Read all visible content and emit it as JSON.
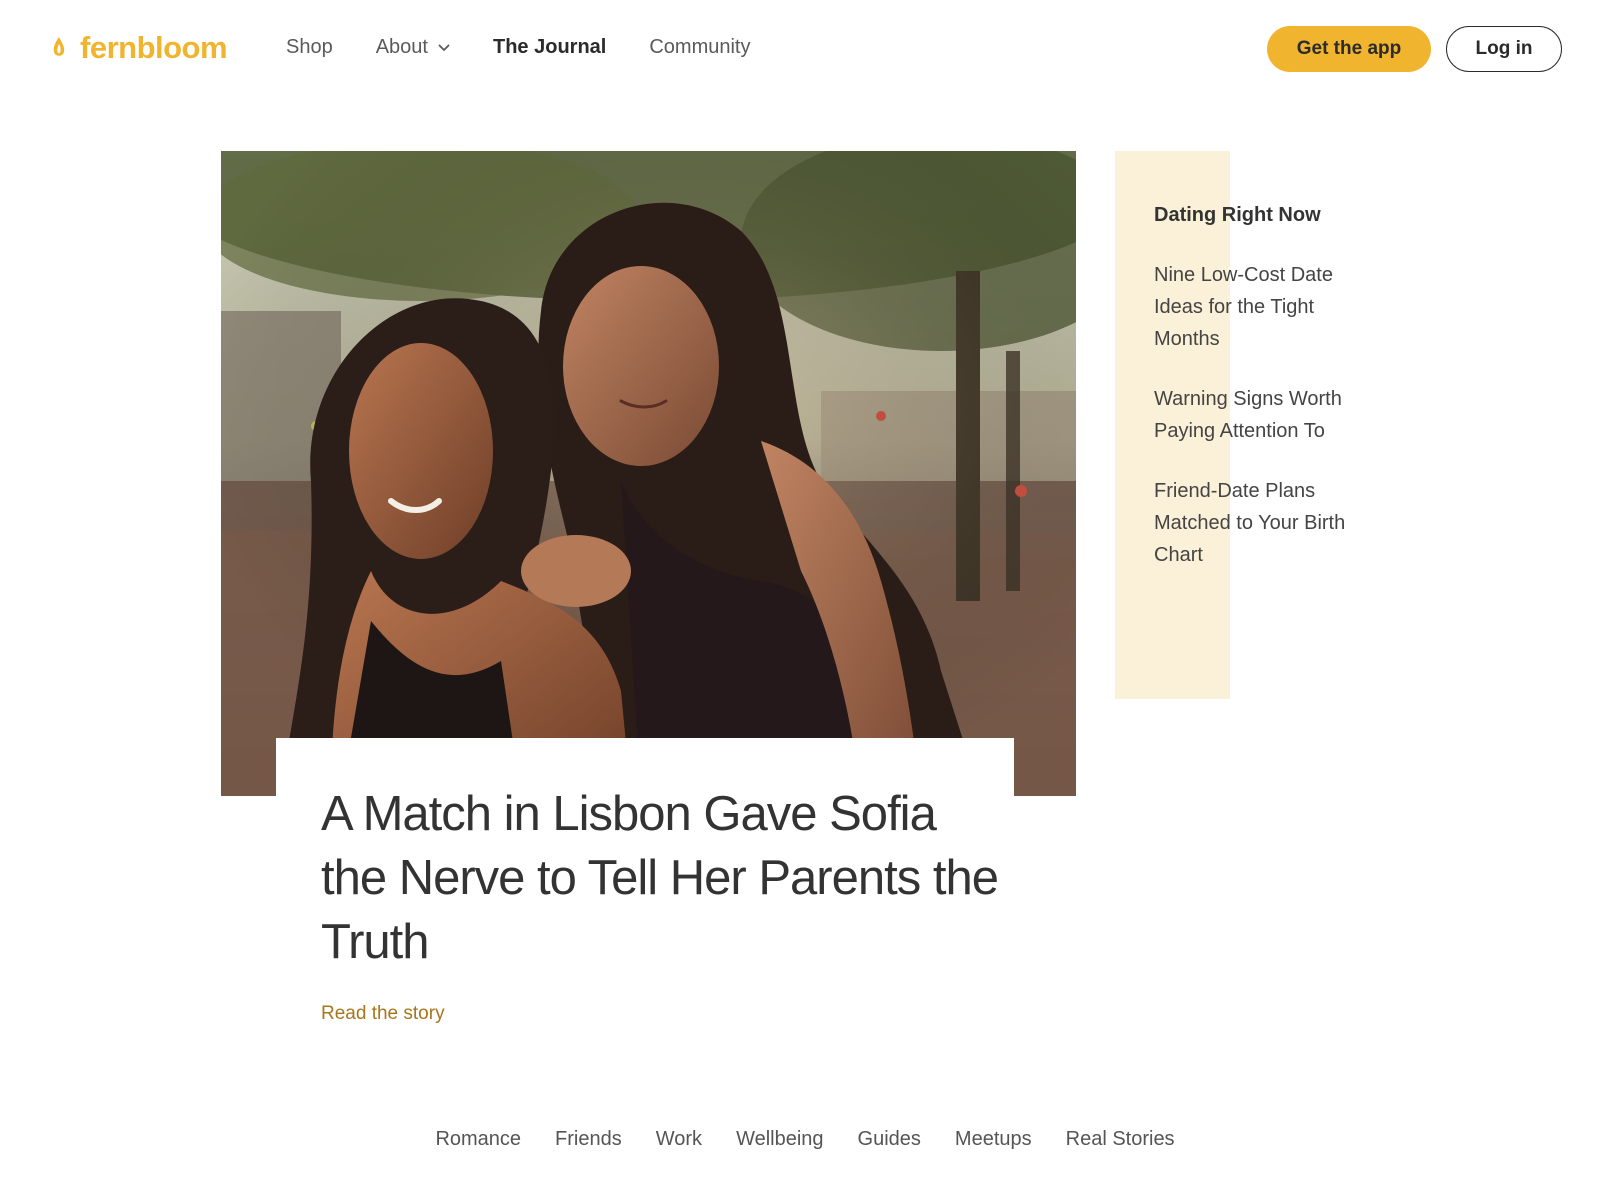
{
  "brand": {
    "name": "fernbloom",
    "accent": "#f1b42f",
    "link_color": "#a8751b",
    "sidebar_bg": "#fbf1d9"
  },
  "nav": {
    "items": [
      {
        "label": "Shop"
      },
      {
        "label": "About",
        "has_dropdown": true
      },
      {
        "label": "The Journal",
        "active": true
      },
      {
        "label": "Community"
      }
    ]
  },
  "actions": {
    "get_app": "Get the app",
    "login": "Log in"
  },
  "hero": {
    "title": "A Match in Lisbon Gave Sofia the Nerve to Tell Her Parents the Truth",
    "link": "Read the story"
  },
  "sidebar": {
    "heading": "Dating Right Now",
    "links": [
      "Nine Low-Cost Date Ideas for the Tight Months",
      "Warning Signs Worth Paying Attention To",
      "Friend-Date Plans Matched to Your Birth Chart"
    ]
  },
  "categories": [
    "Romance",
    "Friends",
    "Work",
    "Wellbeing",
    "Guides",
    "Meetups",
    "Real Stories"
  ]
}
